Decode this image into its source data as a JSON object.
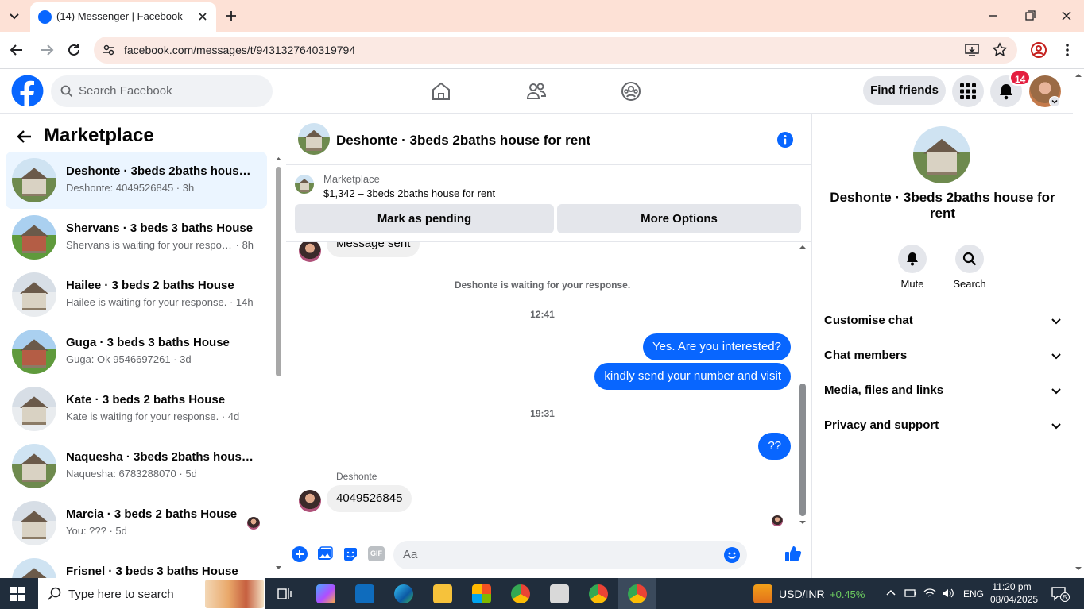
{
  "browser": {
    "tab_title": "(14) Messenger | Facebook",
    "url": "facebook.com/messages/t/9431327640319794"
  },
  "fb_nav": {
    "search_placeholder": "Search Facebook",
    "find_friends": "Find friends",
    "notification_count": "14"
  },
  "left_panel": {
    "title": "Marketplace",
    "conversations": [
      {
        "name": "Deshonte · 3beds 2baths house for rent",
        "preview": "Deshonte: 4049526845",
        "time": "3h",
        "active": true
      },
      {
        "name": "Shervans · 3 beds 3 baths House",
        "preview": "Shervans is waiting for your response.",
        "time": "8h"
      },
      {
        "name": "Hailee · 3 beds 2 baths House",
        "preview": "Hailee is waiting for your response.",
        "time": "14h"
      },
      {
        "name": "Guga · 3 beds 3 baths House",
        "preview": "Guga: Ok 9546697261",
        "time": "3d"
      },
      {
        "name": "Kate · 3 beds 2 baths House",
        "preview": "Kate is waiting for your response.",
        "time": "4d"
      },
      {
        "name": "Naquesha · 3beds 2baths house for rent",
        "preview": "Naquesha: 6783288070",
        "time": "5d"
      },
      {
        "name": "Marcia · 3 beds 2 baths House",
        "preview": "You: ???",
        "time": "5d"
      },
      {
        "name": "Frisnel · 3 beds 3 baths House",
        "preview": "",
        "time": ""
      }
    ]
  },
  "chat": {
    "title": "Deshonte · 3beds 2baths house for rent",
    "marketplace_label": "Marketplace",
    "listing": "$1,342 – 3beds 2baths house for rent",
    "mark_pending": "Mark as pending",
    "more_options": "More Options",
    "messages": {
      "sent_partial": "Message sent",
      "waiting": "Deshonte is waiting for your response.",
      "time1": "12:41",
      "out1": "Yes. Are you interested?",
      "out2": "kindly send your number and visit",
      "time2": "19:31",
      "out3": "??",
      "sender": "Deshonte",
      "in1": "4049526845"
    },
    "composer_placeholder": "Aa"
  },
  "right_panel": {
    "name": "Deshonte · 3beds 2baths house for rent",
    "mute": "Mute",
    "search": "Search",
    "sections": [
      "Customise chat",
      "Chat members",
      "Media, files and links",
      "Privacy and support"
    ]
  },
  "taskbar": {
    "search_text": "Type here to search",
    "ticker": "USD/INR",
    "change": "+0.45%",
    "lang": "ENG",
    "time": "11:20 pm",
    "date": "08/04/2025"
  },
  "colors": {
    "fb_blue": "#0866ff",
    "badge_red": "#e41e3f",
    "tab_strip": "#fde1d6"
  }
}
